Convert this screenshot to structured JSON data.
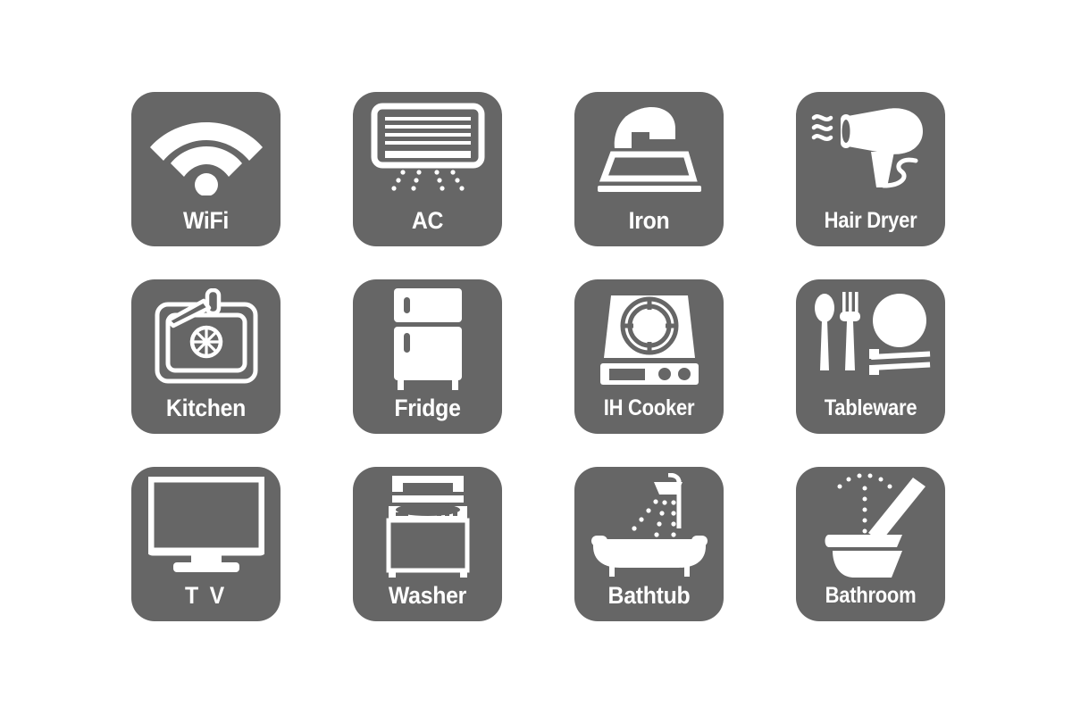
{
  "page": {
    "background_color": "#ffffff",
    "tile_color": "#666666",
    "glyph_color": "#ffffff",
    "columns": 4,
    "rows": 3
  },
  "tiles": [
    {
      "label": "WiFi",
      "icon": "wifi-icon",
      "label_style": "normal"
    },
    {
      "label": "AC",
      "icon": "air-conditioner-icon",
      "label_style": "normal"
    },
    {
      "label": "Iron",
      "icon": "iron-icon",
      "label_style": "normal"
    },
    {
      "label": "Hair Dryer",
      "icon": "hair-dryer-icon",
      "label_style": "wide"
    },
    {
      "label": "Kitchen",
      "icon": "kitchen-sink-icon",
      "label_style": "normal"
    },
    {
      "label": "Fridge",
      "icon": "fridge-icon",
      "label_style": "normal"
    },
    {
      "label": "IH Cooker",
      "icon": "ih-cooker-icon",
      "label_style": "wide"
    },
    {
      "label": "Tableware",
      "icon": "tableware-icon",
      "label_style": "wide"
    },
    {
      "label": "T V",
      "icon": "television-icon",
      "label_style": "spaced"
    },
    {
      "label": "Washer",
      "icon": "washing-machine-icon",
      "label_style": "normal"
    },
    {
      "label": "Bathtub",
      "icon": "bathtub-shower-icon",
      "label_style": "normal"
    },
    {
      "label": "Bathroom",
      "icon": "toilet-icon",
      "label_style": "wide"
    }
  ]
}
